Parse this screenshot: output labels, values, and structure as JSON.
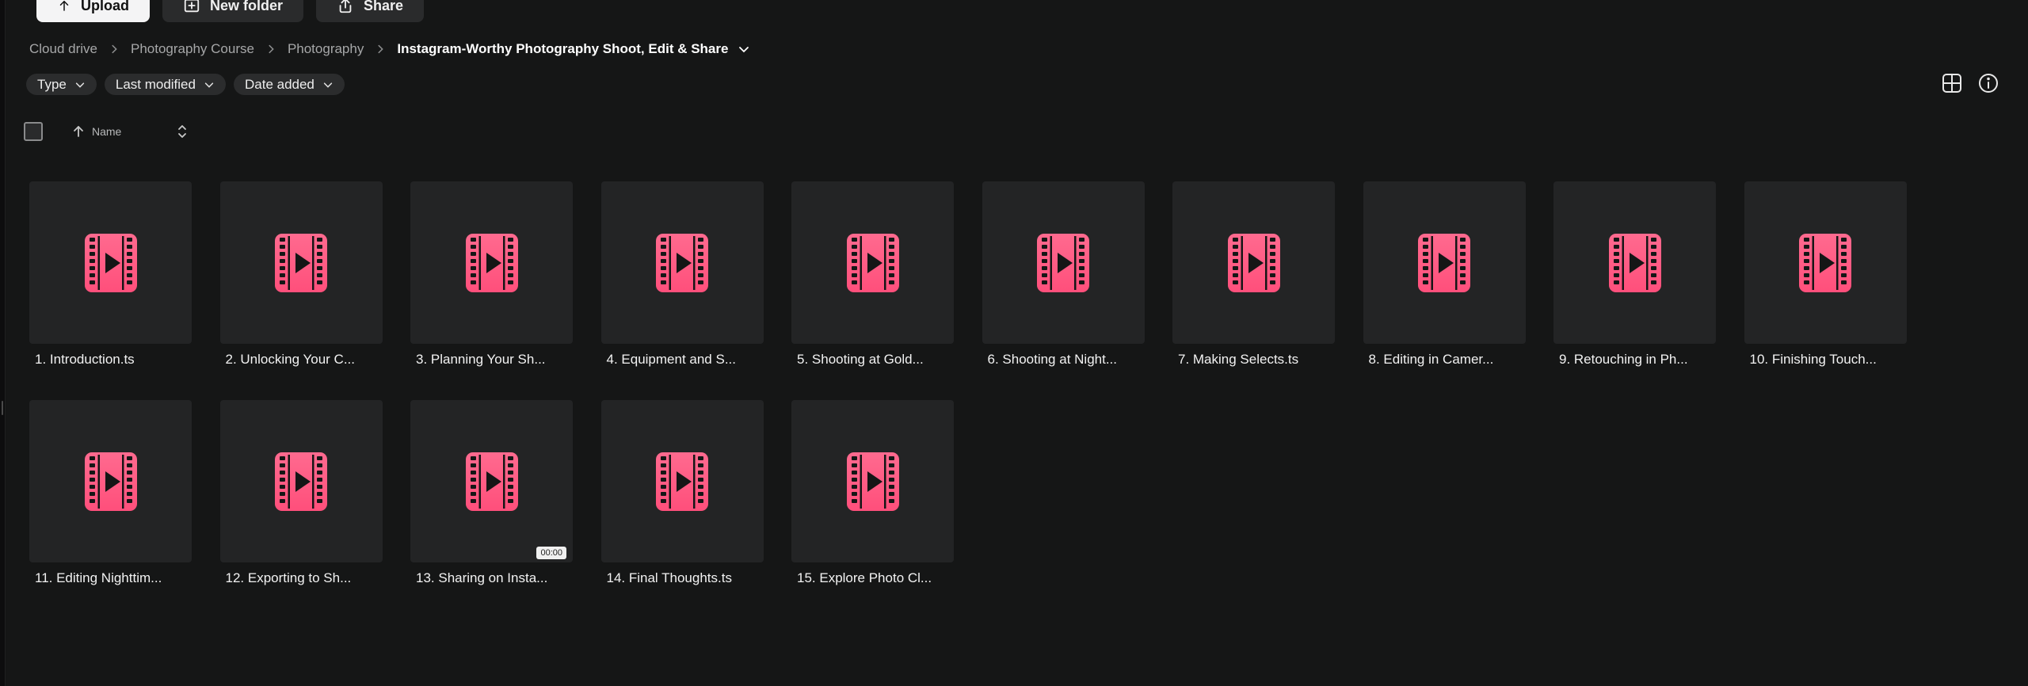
{
  "toolbar": {
    "upload_label": "Upload",
    "new_folder_label": "New folder",
    "share_label": "Share"
  },
  "breadcrumb": [
    {
      "label": "Cloud drive"
    },
    {
      "label": "Photography Course"
    },
    {
      "label": "Photography"
    },
    {
      "label": "Instagram-Worthy Photography Shoot, Edit & Share"
    }
  ],
  "filters": [
    {
      "label": "Type"
    },
    {
      "label": "Last modified"
    },
    {
      "label": "Date added"
    }
  ],
  "sort": {
    "label": "Name"
  },
  "colors": {
    "accent": "#ff4f7b",
    "background": "#151616",
    "tile": "#232425"
  },
  "files": [
    {
      "name": "1. Introduction.ts",
      "icon": "video-file-icon"
    },
    {
      "name": "2. Unlocking Your C...",
      "icon": "video-file-icon"
    },
    {
      "name": "3. Planning Your Sh...",
      "icon": "video-file-icon"
    },
    {
      "name": "4. Equipment and S...",
      "icon": "video-file-icon"
    },
    {
      "name": "5. Shooting at Gold...",
      "icon": "video-file-icon"
    },
    {
      "name": "6. Shooting at Night...",
      "icon": "video-file-icon"
    },
    {
      "name": "7. Making Selects.ts",
      "icon": "video-file-icon"
    },
    {
      "name": "8. Editing in Camer...",
      "icon": "video-file-icon"
    },
    {
      "name": "9. Retouching in Ph...",
      "icon": "video-file-icon"
    },
    {
      "name": "10. Finishing Touch...",
      "icon": "video-file-icon"
    },
    {
      "name": "11. Editing Nighttim...",
      "icon": "video-file-icon"
    },
    {
      "name": "12. Exporting to Sh...",
      "icon": "video-file-icon"
    },
    {
      "name": "13. Sharing on Insta...",
      "icon": "video-file-icon",
      "duration": "00:00"
    },
    {
      "name": "14. Final Thoughts.ts",
      "icon": "video-file-icon"
    },
    {
      "name": "15. Explore Photo Cl...",
      "icon": "video-file-icon"
    }
  ]
}
